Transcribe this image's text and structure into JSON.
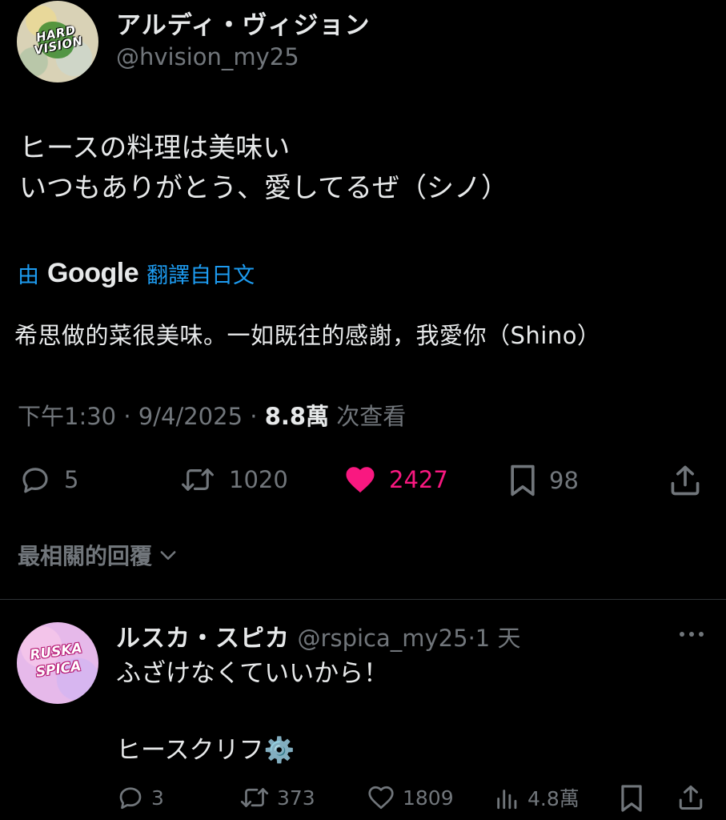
{
  "tweet": {
    "author": {
      "display_name": "アルディ・ヴィジョン",
      "handle": "@hvision_my25",
      "avatar_text": "HARD VISION"
    },
    "text_lines": [
      "ヒースの料理は美味い",
      "いつもありがとう、愛してるぜ（シノ）"
    ],
    "translation": {
      "prefix": "由",
      "provider": "Google",
      "suffix": "翻譯自日文",
      "text": "希思做的菜很美味。一如既往的感謝，我愛你（Shino）"
    },
    "meta": {
      "time": "下午1:30",
      "date": "9/4/2025",
      "views_count": "8.8萬",
      "views_label": "次查看"
    },
    "actions": {
      "replies": "5",
      "retweets": "1020",
      "likes": "2427",
      "bookmarks": "98"
    }
  },
  "replies_section": {
    "sort_label": "最相關的回覆"
  },
  "reply": {
    "author": {
      "display_name": "ルスカ・スピカ",
      "handle": "@rspica_my25",
      "age": "1 天",
      "avatar_text": "RUSKA SPICA"
    },
    "text_lines": [
      "ふざけなくていいから！",
      "",
      "ヒースクリフ⚙️"
    ],
    "actions": {
      "replies": "3",
      "retweets": "373",
      "likes": "1809",
      "views": "4.8萬"
    }
  },
  "colors": {
    "background": "#000000",
    "text": "#e7e9ea",
    "muted": "#71767b",
    "link": "#1d9bf0",
    "like": "#f91880",
    "divider": "#2f3336"
  }
}
